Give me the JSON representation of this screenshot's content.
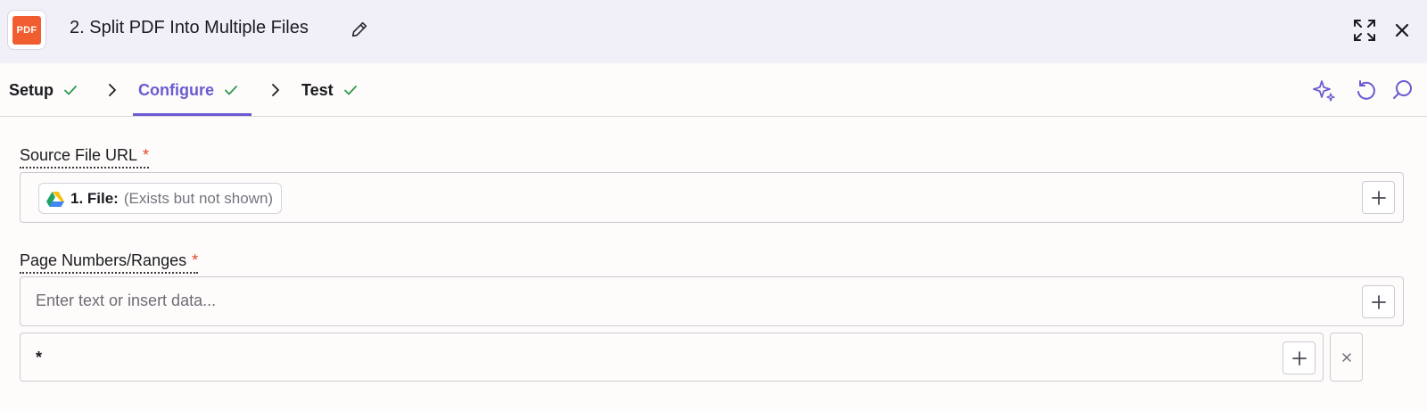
{
  "header": {
    "logo_text": "PDF",
    "title": "2. Split PDF Into Multiple Files",
    "edit_icon": "pencil-icon",
    "expand_icon": "expand-icon",
    "close_icon": "close-icon"
  },
  "tabs": [
    {
      "label": "Setup",
      "status": "complete"
    },
    {
      "label": "Configure",
      "status": "complete",
      "active": true
    },
    {
      "label": "Test",
      "status": "complete"
    }
  ],
  "toolbar": {
    "icons": [
      "sparkle-icon",
      "undo-icon",
      "search-icon"
    ]
  },
  "fields": {
    "source": {
      "label": "Source File URL",
      "required_mark": "*",
      "pill_label": "1. File:",
      "pill_value": "(Exists but not shown)",
      "pill_icon": "google-drive-icon"
    },
    "pages": {
      "label": "Page Numbers/Ranges",
      "required_mark": "*",
      "placeholder": "Enter text or insert data...",
      "row_value": "*"
    }
  },
  "colors": {
    "accent": "#6a5bd2",
    "check": "#2d9a4f",
    "required": "#e3482c",
    "header_bg": "#f1f0f9",
    "logo_bg": "#f05d2f"
  }
}
